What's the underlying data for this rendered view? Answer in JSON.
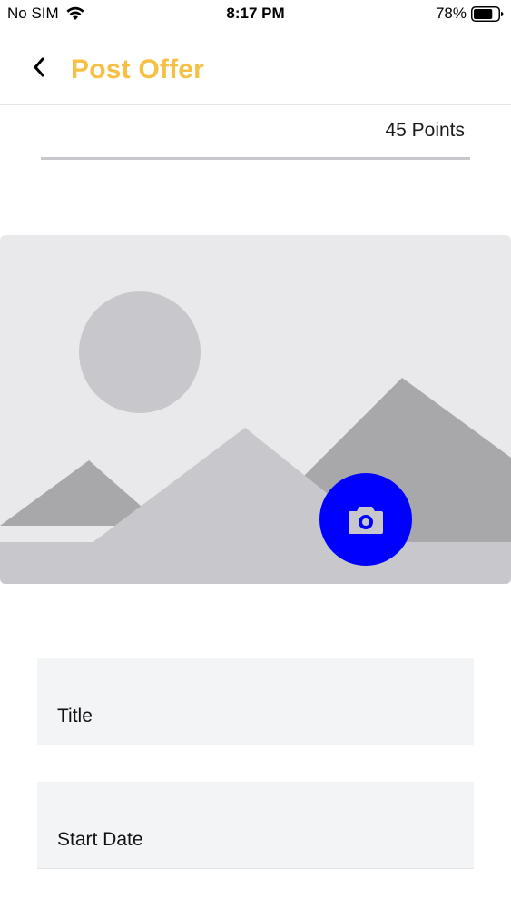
{
  "status_bar": {
    "carrier": "No SIM",
    "time": "8:17 PM",
    "battery_percent": "78%",
    "battery_level": 0.78
  },
  "nav": {
    "title": "Post Offer",
    "title_color": "#f5c043",
    "back_icon": "chevron-left-icon"
  },
  "points": {
    "label": "45 Points"
  },
  "image_picker": {
    "placeholder_icon": "image-placeholder-icon",
    "camera_icon": "camera-icon",
    "camera_button_color": "#0000ff"
  },
  "form": {
    "title_label": "Title",
    "start_date_label": "Start Date"
  }
}
